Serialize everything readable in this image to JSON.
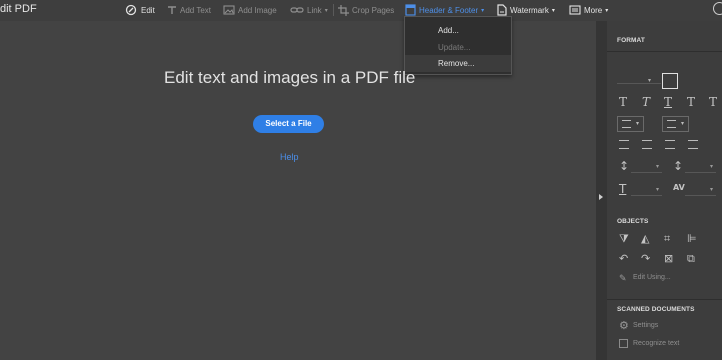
{
  "app": {
    "title": "dit PDF"
  },
  "toolbar": {
    "edit": "Edit",
    "add_text": "Add Text",
    "add_image": "Add Image",
    "link": "Link",
    "crop_pages": "Crop Pages",
    "header_footer": "Header & Footer",
    "watermark": "Watermark",
    "more": "More",
    "accent_color": "#4d8fe8"
  },
  "dropdown": {
    "items": [
      {
        "label": "Add...",
        "enabled": true
      },
      {
        "label": "Update...",
        "enabled": false
      },
      {
        "label": "Remove...",
        "enabled": true
      }
    ]
  },
  "main": {
    "heading": "Edit text and images in a PDF file",
    "select_button": "Select a File",
    "help": "Help",
    "button_color": "#2f7fe6"
  },
  "panel": {
    "format": {
      "title": "FORMAT",
      "style_glyphs": [
        "T",
        "T",
        "T",
        "T",
        "T"
      ],
      "spacing_glyph": "AV"
    },
    "objects": {
      "title": "OBJECTS",
      "edit_using": "Edit Using..."
    },
    "scanned": {
      "title": "SCANNED DOCUMENTS",
      "settings": "Settings",
      "recognize": "Recognize text"
    }
  }
}
